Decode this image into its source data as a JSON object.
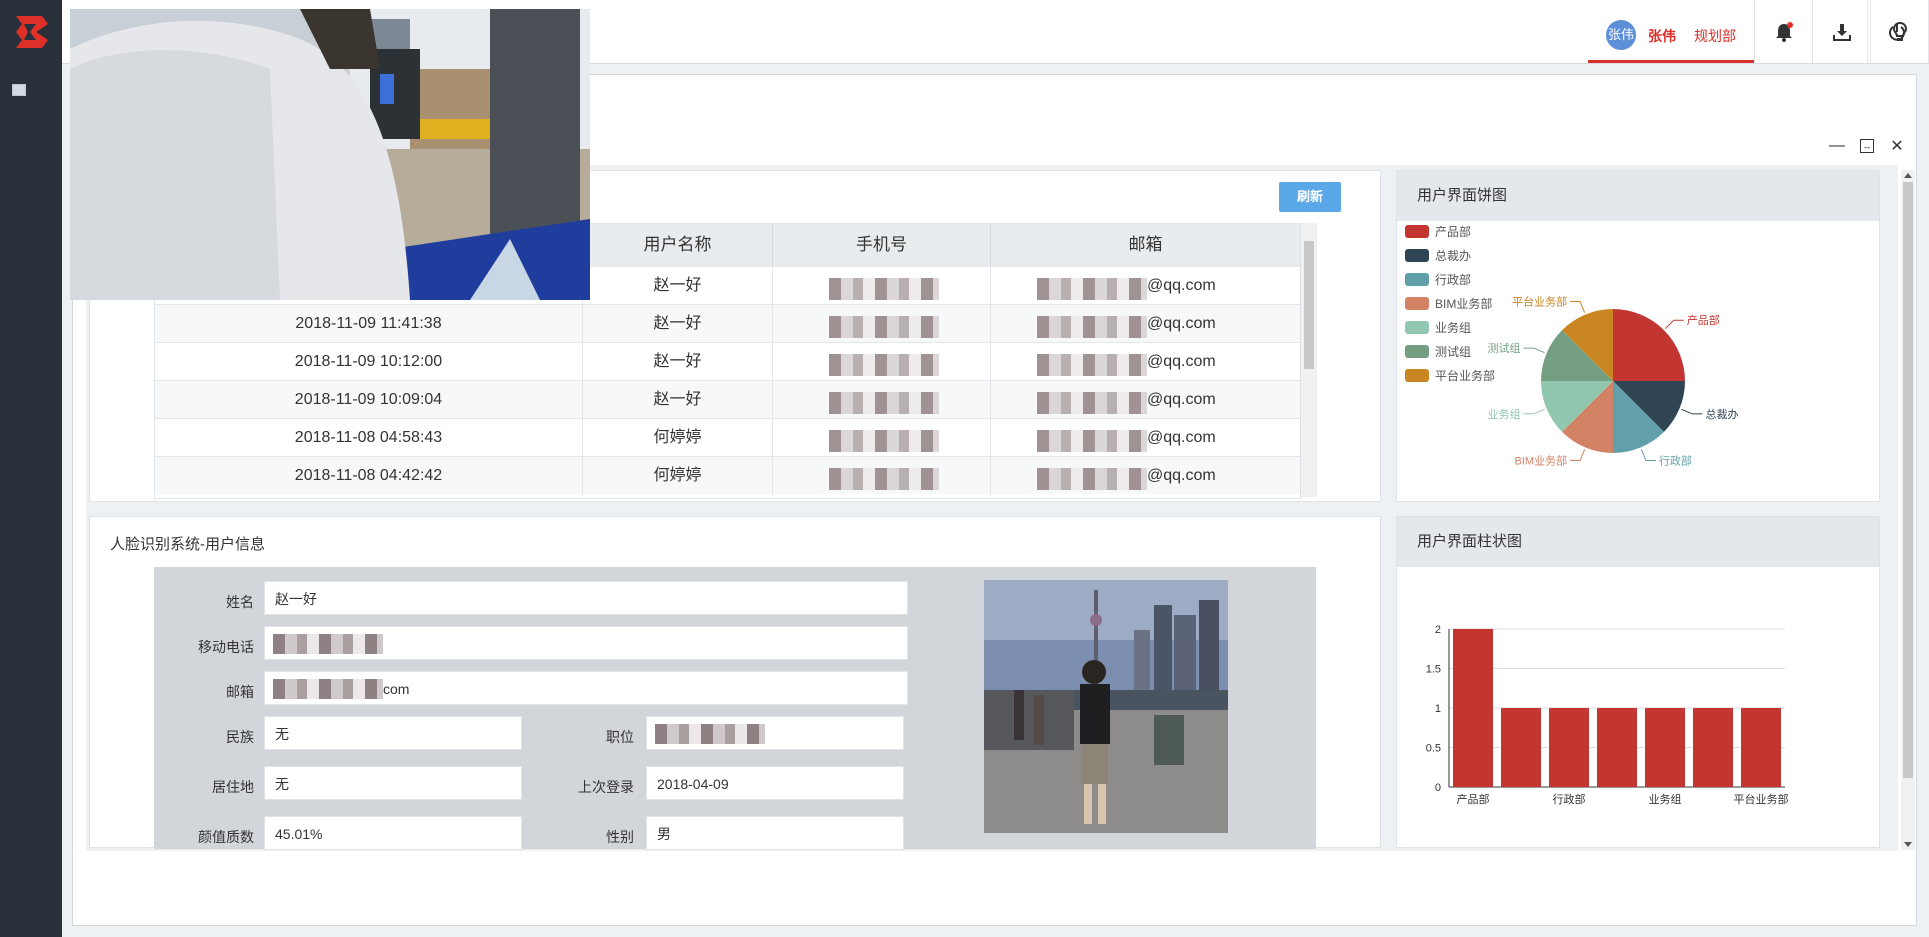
{
  "user": {
    "avatar_text": "张伟",
    "name": "张伟",
    "dept": "规划部"
  },
  "table": {
    "refresh_label": "刷新",
    "headers": [
      "用户名称",
      "手机号",
      "邮箱"
    ],
    "rows": [
      {
        "time": "",
        "name": "赵一好",
        "email_suffix": "@qq.com"
      },
      {
        "time": "2018-11-09 11:41:38",
        "name": "赵一好",
        "email_suffix": "@qq.com"
      },
      {
        "time": "2018-11-09 10:12:00",
        "name": "赵一好",
        "email_suffix": "@qq.com"
      },
      {
        "time": "2018-11-09 10:09:04",
        "name": "赵一好",
        "email_suffix": "@qq.com"
      },
      {
        "time": "2018-11-08 04:58:43",
        "name": "何婷婷",
        "email_suffix": "@qq.com"
      },
      {
        "time": "2018-11-08 04:42:42",
        "name": "何婷婷",
        "email_suffix": "@qq.com"
      }
    ]
  },
  "info": {
    "title": "人脸识别系统-用户信息",
    "fields": {
      "name_label": "姓名",
      "name_value": "赵一好",
      "mobile_label": "移动电话",
      "email_label": "邮箱",
      "email_suffix": "com",
      "ethnic_label": "民族",
      "ethnic_value": "无",
      "position_label": "职位",
      "residence_label": "居住地",
      "residence_value": "无",
      "last_login_label": "上次登录",
      "last_login_value": "2018-04-09",
      "score_label": "颜值质数",
      "score_value": "45.01%",
      "gender_label": "性别",
      "gender_value": "男"
    }
  },
  "pie": {
    "title": "用户界面饼图",
    "legend": [
      {
        "name": "产品部",
        "color": "#c23531"
      },
      {
        "name": "总裁办",
        "color": "#2f4554"
      },
      {
        "name": "行政部",
        "color": "#61a0a8"
      },
      {
        "name": "BIM业务部",
        "color": "#d48265"
      },
      {
        "name": "业务组",
        "color": "#91c7ae"
      },
      {
        "name": "测试组",
        "color": "#749f83"
      },
      {
        "name": "平台业务部",
        "color": "#ca8622"
      }
    ]
  },
  "bar": {
    "title": "用户界面柱状图",
    "y_ticks": [
      "0",
      "0.5",
      "1",
      "1.5",
      "2"
    ],
    "x_labels": [
      "产品部",
      "行政部",
      "业务组",
      "平台业务部"
    ]
  },
  "chart_data": [
    {
      "type": "pie",
      "title": "用户界面饼图",
      "categories": [
        "产品部",
        "总裁办",
        "行政部",
        "BIM业务部",
        "业务组",
        "测试组",
        "平台业务部"
      ],
      "values": [
        2,
        1,
        1,
        1,
        1,
        1,
        1
      ],
      "colors": [
        "#c23531",
        "#2f4554",
        "#61a0a8",
        "#d48265",
        "#91c7ae",
        "#749f83",
        "#ca8622"
      ]
    },
    {
      "type": "bar",
      "title": "用户界面柱状图",
      "categories": [
        "产品部",
        "总裁办",
        "行政部",
        "BIM业务部",
        "业务组",
        "测试组",
        "平台业务部"
      ],
      "values": [
        2,
        1,
        1,
        1,
        1,
        1,
        1
      ],
      "ylim": [
        0,
        2
      ],
      "color": "#c23531"
    }
  ]
}
